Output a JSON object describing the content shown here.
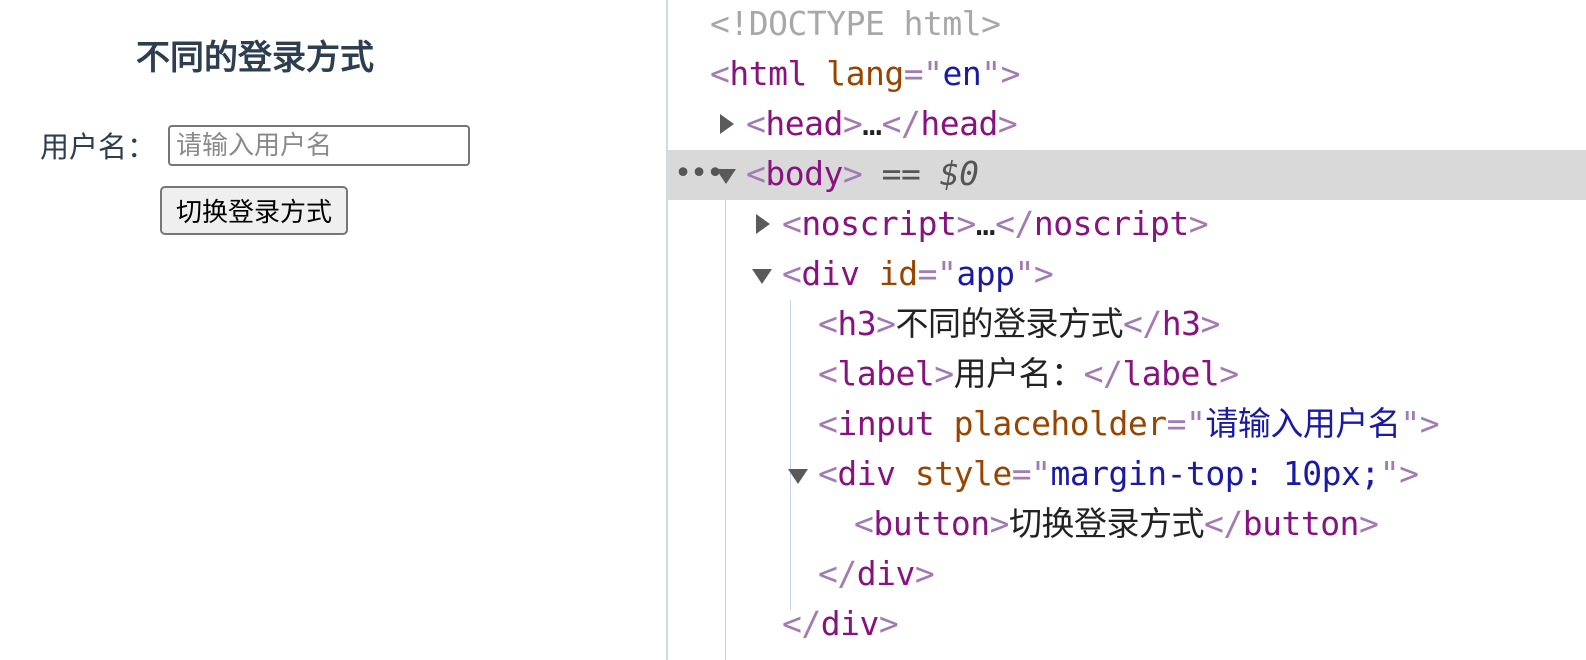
{
  "preview": {
    "heading": "不同的登录方式",
    "username_label": "用户名：",
    "username_placeholder": "请输入用户名",
    "switch_button": "切换登录方式"
  },
  "devtools": {
    "doctype": "<!DOCTYPE html>",
    "html": {
      "open": "<",
      "tag": "html",
      "attr": "lang",
      "eq": "=\"",
      "value": "en",
      "close": "\">"
    },
    "head": {
      "open": "<",
      "tag": "head",
      "mid": ">",
      "ellipsis": "…",
      "end_open": "</",
      "end_tag": "head",
      "end_close": ">"
    },
    "body": {
      "dots": "•••",
      "open": "<",
      "tag": "body",
      "close": ">",
      "marker": " == ",
      "var": "$0"
    },
    "noscript": {
      "open": "<",
      "tag": "noscript",
      "mid": ">",
      "ellipsis": "…",
      "end_open": "</",
      "end_tag": "noscript",
      "end_close": ">"
    },
    "div_app": {
      "open": "<",
      "tag": "div",
      "attr": "id",
      "eq": "=\"",
      "value": "app",
      "close": "\">"
    },
    "h3": {
      "open": "<",
      "tag": "h3",
      "mid": ">",
      "text": "不同的登录方式",
      "end_open": "</",
      "end_tag": "h3",
      "end_close": ">"
    },
    "label": {
      "open": "<",
      "tag": "label",
      "mid": ">",
      "text": "用户名：",
      "end_open": "</",
      "end_tag": "label",
      "end_close": ">"
    },
    "input": {
      "open": "<",
      "tag": "input",
      "attr": "placeholder",
      "eq": "=\"",
      "value": "请输入用户名",
      "close": "\">"
    },
    "div_style": {
      "open": "<",
      "tag": "div",
      "attr": "style",
      "eq": "=\"",
      "value": "margin-top: 10px;",
      "close": "\">"
    },
    "button": {
      "open": "<",
      "tag": "button",
      "mid": ">",
      "text": "切换登录方式",
      "end_open": "</",
      "end_tag": "button",
      "end_close": ">"
    },
    "div_close_inner": {
      "open": "</",
      "tag": "div",
      "close": ">"
    },
    "div_close_outer": {
      "open": "</",
      "tag": "div",
      "close": ">"
    }
  }
}
